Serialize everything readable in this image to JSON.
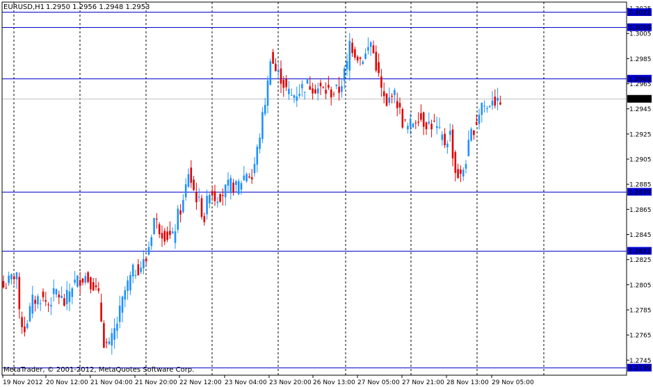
{
  "header": {
    "symbol": "EURUSD,H1",
    "ohlc": "1.2950 1.2956 1.2948 1.2953"
  },
  "footer": {
    "copyright": "MetaTrader, © 2001-2012, MetaQuotes Software Corp."
  },
  "chart_data": {
    "type": "candlestick",
    "ylim": [
      1.2733,
      1.303
    ],
    "y_ticks": [
      "1.3025",
      "1.3005",
      "1.2985",
      "1.2965",
      "1.2945",
      "1.2925",
      "1.2905",
      "1.2885",
      "1.2865",
      "1.2845",
      "1.2825",
      "1.2805",
      "1.2785",
      "1.2765",
      "1.2745"
    ],
    "x_ticks": [
      "19 Nov 2012",
      "20 Nov 12:00",
      "21 Nov 04:00",
      "21 Nov 20:00",
      "22 Nov 12:00",
      "23 Nov 04:00",
      "23 Nov 20:00",
      "26 Nov 13:00",
      "27 Nov 05:00",
      "27 Nov 21:00",
      "28 Nov 13:00",
      "29 Nov 05:00"
    ],
    "grid": true,
    "colors": {
      "bull": "#1e90ff",
      "bear": "#e00000",
      "hline": "#0000cc",
      "bid": "#c0c0c0",
      "grid": "#000000"
    },
    "horizontal_lines": [
      {
        "price": 1.3022,
        "label": "1.3022"
      },
      {
        "price": 1.301,
        "label": "1.3010"
      },
      {
        "price": 1.2969,
        "label": "1.2969"
      },
      {
        "price": 1.2879,
        "label": "1.2879"
      },
      {
        "price": 1.2832,
        "label": "1.2832"
      },
      {
        "price": 1.2739,
        "label": "1.2739"
      }
    ],
    "current_price": {
      "price": 1.2953,
      "label": "1.2953"
    },
    "anchors": [
      [
        0,
        1.2803
      ],
      [
        3,
        1.281
      ],
      [
        5,
        1.2815
      ],
      [
        6,
        1.278
      ],
      [
        8,
        1.277
      ],
      [
        11,
        1.2792
      ],
      [
        14,
        1.2795
      ],
      [
        17,
        1.279
      ],
      [
        20,
        1.28
      ],
      [
        23,
        1.279
      ],
      [
        26,
        1.2805
      ],
      [
        29,
        1.281
      ],
      [
        31,
        1.2812
      ],
      [
        34,
        1.2805
      ],
      [
        36,
        1.2795
      ],
      [
        38,
        1.276
      ],
      [
        40,
        1.2755
      ],
      [
        43,
        1.2775
      ],
      [
        46,
        1.28
      ],
      [
        49,
        1.2815
      ],
      [
        52,
        1.282
      ],
      [
        54,
        1.2825
      ],
      [
        57,
        1.2858
      ],
      [
        59,
        1.285
      ],
      [
        61,
        1.2845
      ],
      [
        64,
        1.2842
      ],
      [
        66,
        1.286
      ],
      [
        68,
        1.287
      ],
      [
        70,
        1.2895
      ],
      [
        72,
        1.288
      ],
      [
        74,
        1.287
      ],
      [
        76,
        1.2858
      ],
      [
        78,
        1.2882
      ],
      [
        80,
        1.2875
      ],
      [
        83,
        1.2878
      ],
      [
        86,
        1.2885
      ],
      [
        88,
        1.2882
      ],
      [
        90,
        1.2888
      ],
      [
        92,
        1.2895
      ],
      [
        94,
        1.289
      ],
      [
        96,
        1.2912
      ],
      [
        98,
        1.2938
      ],
      [
        100,
        1.2965
      ],
      [
        101,
        1.2988
      ],
      [
        103,
        1.2975
      ],
      [
        105,
        1.297
      ],
      [
        107,
        1.296
      ],
      [
        109,
        1.2955
      ],
      [
        111,
        1.2958
      ],
      [
        113,
        1.2962
      ],
      [
        115,
        1.2965
      ],
      [
        118,
        1.2962
      ],
      [
        121,
        1.296
      ],
      [
        124,
        1.2958
      ],
      [
        127,
        1.296
      ],
      [
        130,
        1.298
      ],
      [
        131,
        1.2998
      ],
      [
        133,
        1.299
      ],
      [
        135,
        1.2985
      ],
      [
        137,
        1.2988
      ],
      [
        139,
        1.2998
      ],
      [
        141,
        1.298
      ],
      [
        143,
        1.296
      ],
      [
        145,
        1.2945
      ],
      [
        147,
        1.296
      ],
      [
        149,
        1.295
      ],
      [
        151,
        1.2935
      ],
      [
        153,
        1.293
      ],
      [
        155,
        1.2935
      ],
      [
        157,
        1.294
      ],
      [
        159,
        1.2935
      ],
      [
        161,
        1.2933
      ],
      [
        163,
        1.2932
      ],
      [
        165,
        1.2925
      ],
      [
        167,
        1.2918
      ],
      [
        169,
        1.2925
      ],
      [
        171,
        1.2895
      ],
      [
        173,
        1.289
      ],
      [
        175,
        1.2905
      ],
      [
        177,
        1.2925
      ],
      [
        179,
        1.2935
      ],
      [
        181,
        1.295
      ],
      [
        183,
        1.2945
      ],
      [
        185,
        1.2955
      ],
      [
        187,
        1.2948
      ],
      [
        188,
        1.2953
      ]
    ]
  }
}
